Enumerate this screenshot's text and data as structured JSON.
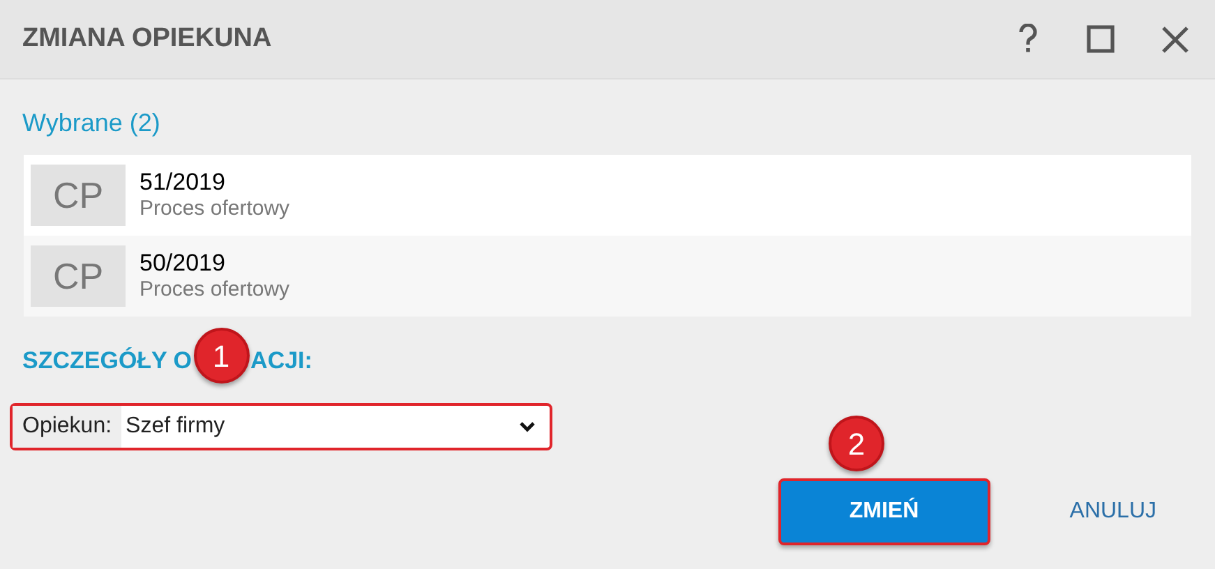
{
  "window": {
    "title": "ZMIANA OPIEKUNA"
  },
  "selected_header": "Wybrane (2)",
  "items": [
    {
      "badge": "CP",
      "number": "51/2019",
      "subtitle": "Proces ofertowy"
    },
    {
      "badge": "CP",
      "number": "50/2019",
      "subtitle": "Proces ofertowy"
    }
  ],
  "details_heading": [
    "SZCZEGÓŁY O",
    "ACJI:"
  ],
  "owner_field": {
    "label": "Opiekun:",
    "value": "Szef firmy",
    "highlighted": true
  },
  "buttons": [
    {
      "label": "ZMIEŃ",
      "kind": "primary",
      "highlighted": true
    },
    {
      "label": "ANULUJ",
      "kind": "link",
      "highlighted": false
    }
  ],
  "annotations": [
    {
      "label": "1"
    },
    {
      "label": "2"
    }
  ]
}
